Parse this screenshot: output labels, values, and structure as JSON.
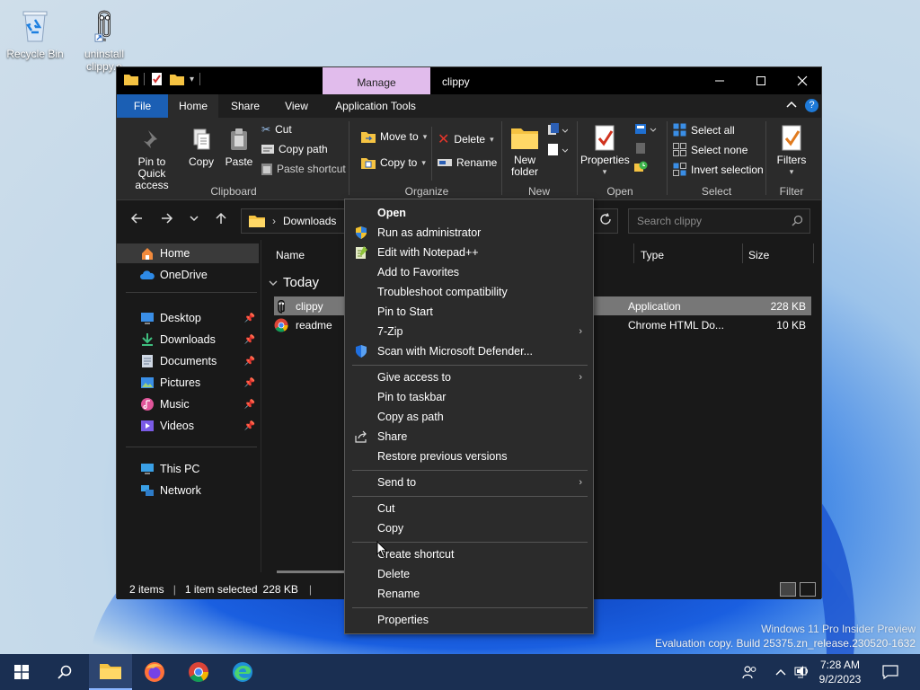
{
  "desktop": {
    "icons": [
      {
        "label": "Recycle Bin"
      },
      {
        "label": "uninstall clippy.e"
      }
    ],
    "watermark": {
      "line1": "Windows 11 Pro Insider Preview",
      "line2": "Evaluation copy. Build 25375.zn_release.230520-1632"
    }
  },
  "window": {
    "title": "clippy",
    "contextual_tab": "Manage",
    "tabs": [
      "File",
      "Home",
      "Share",
      "View",
      "Application Tools"
    ],
    "active_tab": "Home",
    "ribbon": {
      "clipboard": {
        "label": "Clipboard",
        "pin": "Pin to Quick access",
        "copy": "Copy",
        "paste": "Paste",
        "cut": "Cut",
        "copy_path": "Copy path",
        "paste_shortcut": "Paste shortcut"
      },
      "organize": {
        "label": "Organize",
        "move_to": "Move to",
        "copy_to": "Copy to",
        "delete": "Delete",
        "rename": "Rename"
      },
      "new": {
        "label": "New",
        "new_folder": "New folder"
      },
      "open": {
        "label": "Open",
        "properties": "Properties"
      },
      "select": {
        "label": "Select",
        "select_all": "Select all",
        "select_none": "Select none",
        "invert": "Invert selection"
      },
      "filter": {
        "label": "Filter",
        "filters": "Filters"
      }
    },
    "address": {
      "path": "Downloads",
      "search_placeholder": "Search clippy"
    },
    "nav": [
      {
        "label": "Home"
      },
      {
        "label": "OneDrive"
      },
      {
        "label": "Desktop"
      },
      {
        "label": "Downloads"
      },
      {
        "label": "Documents"
      },
      {
        "label": "Pictures"
      },
      {
        "label": "Music"
      },
      {
        "label": "Videos"
      },
      {
        "label": "This PC"
      },
      {
        "label": "Network"
      }
    ],
    "columns": {
      "name": "Name",
      "type": "Type",
      "size": "Size"
    },
    "group_label": "Today",
    "files": [
      {
        "name": "clippy",
        "type": "Application",
        "size": "228 KB"
      },
      {
        "name": "readme",
        "type": "Chrome HTML Do...",
        "size": "10 KB"
      }
    ],
    "status": {
      "items": "2 items",
      "selected": "1 item selected",
      "size": "228 KB",
      "sep": "|"
    }
  },
  "context_menu": {
    "items": [
      {
        "label": "Open"
      },
      {
        "label": "Run as administrator"
      },
      {
        "label": "Edit with Notepad++"
      },
      {
        "label": "Add to Favorites"
      },
      {
        "label": "Troubleshoot compatibility"
      },
      {
        "label": "Pin to Start"
      },
      {
        "label": "7-Zip"
      },
      {
        "label": "Scan with Microsoft Defender..."
      },
      {
        "label": "Give access to"
      },
      {
        "label": "Pin to taskbar"
      },
      {
        "label": "Copy as path"
      },
      {
        "label": "Share"
      },
      {
        "label": "Restore previous versions"
      },
      {
        "label": "Send to"
      },
      {
        "label": "Cut"
      },
      {
        "label": "Copy"
      },
      {
        "label": "Create shortcut"
      },
      {
        "label": "Delete"
      },
      {
        "label": "Rename"
      },
      {
        "label": "Properties"
      }
    ],
    "submenu_arrow": "›"
  },
  "taskbar": {
    "time": "7:28 AM",
    "date": "9/2/2023"
  },
  "colors": {
    "manage_tab": "#e1bcec",
    "file_tab": "#1b5fb4",
    "menu_bg": "#2b2b2b",
    "taskbar": "#1a2f52"
  }
}
